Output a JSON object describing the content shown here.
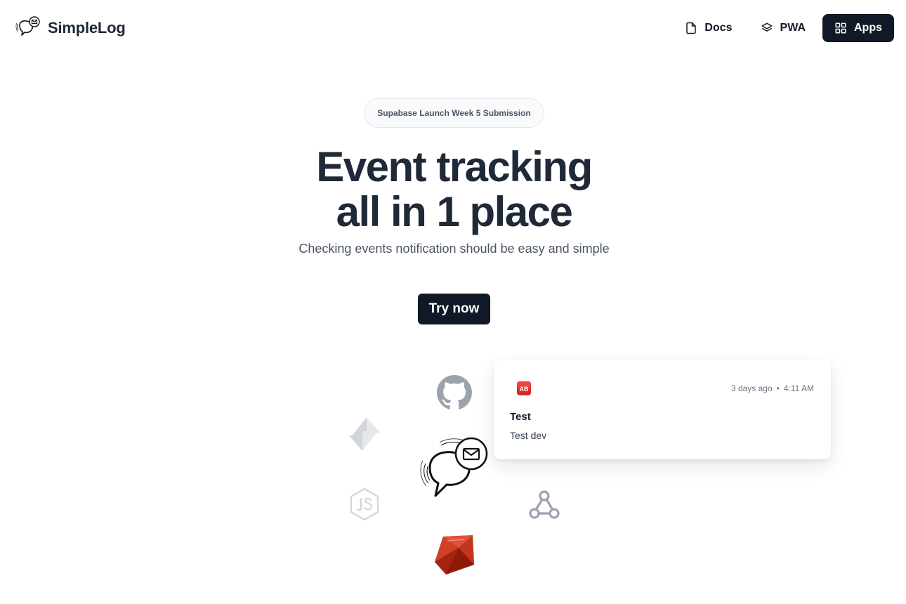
{
  "header": {
    "brand_name": "SimpleLog",
    "nav": [
      {
        "label": "Docs",
        "icon": "document-icon"
      },
      {
        "label": "PWA",
        "icon": "layers-icon"
      },
      {
        "label": "Apps",
        "icon": "grid-icon"
      }
    ]
  },
  "hero": {
    "badge": "Supabase Launch Week 5 Submission",
    "headline_line1": "Event tracking",
    "headline_line2": "all in 1 place",
    "subheadline": "Checking events notification should be easy and simple",
    "cta_label": "Try now"
  },
  "integrations": [
    {
      "icon": "github-icon"
    },
    {
      "icon": "supabase-icon"
    },
    {
      "icon": "simplelog-chat-icon"
    },
    {
      "icon": "nodejs-icon"
    },
    {
      "icon": "webhook-icon"
    },
    {
      "icon": "ruby-icon"
    }
  ],
  "notification": {
    "app_icon_text": "AB",
    "time_relative": "3 days ago",
    "separator": "•",
    "time_clock": "4:11 AM",
    "title": "Test",
    "description": "Test dev"
  },
  "colors": {
    "primary_dark": "#111827",
    "headline": "#1f2937",
    "muted_text": "#4b5563",
    "ruby_red": "#b4260f",
    "app_badge_red": "#dc2626"
  }
}
